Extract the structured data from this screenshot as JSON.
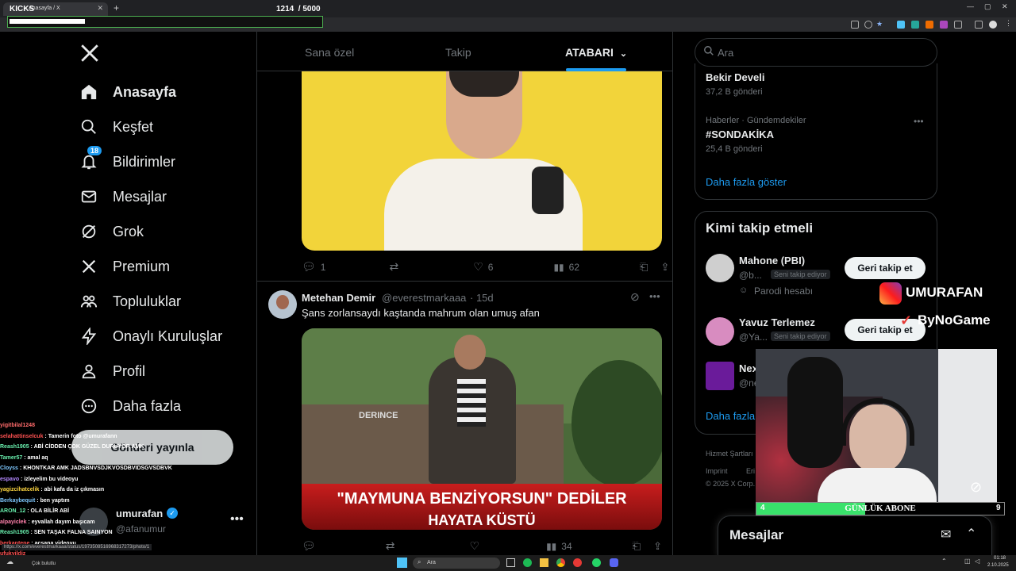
{
  "browser": {
    "tab_title": "Anasayfa / X",
    "overlay_title": "KICKS",
    "counter": "1214  / 5000"
  },
  "sidebar": {
    "items": [
      {
        "label": "Anasayfa",
        "icon": "home-icon"
      },
      {
        "label": "Keşfet",
        "icon": "search-icon"
      },
      {
        "label": "Bildirimler",
        "icon": "bell-icon",
        "badge": "18"
      },
      {
        "label": "Mesajlar",
        "icon": "mail-icon"
      },
      {
        "label": "Grok",
        "icon": "grok-icon"
      },
      {
        "label": "Premium",
        "icon": "x-icon"
      },
      {
        "label": "Topluluklar",
        "icon": "people-icon"
      },
      {
        "label": "Onaylı Kuruluşlar",
        "icon": "lightning-icon"
      },
      {
        "label": "Profil",
        "icon": "person-icon"
      },
      {
        "label": "Daha fazla",
        "icon": "more-circle-icon"
      }
    ],
    "post_button": "Gönderi yayınla",
    "account": {
      "name": "umurafan",
      "handle": "@afanumur"
    }
  },
  "feed": {
    "tabs": [
      "Sana özel",
      "Takip",
      "ATABARI"
    ],
    "post1_actions": {
      "replies": "1",
      "likes": "6",
      "views": "62"
    },
    "post2": {
      "author": "Metehan Demir",
      "handle": "@everestmarkaaa",
      "time": "· 15d",
      "text": "Şans zorlansaydı kaştanda mahrum olan umuş afan",
      "image_caption_1": "\"MAYMUNA BENZİYORSUN\" DEDİLER",
      "image_caption_2": "HAYATA KÜSTÜ",
      "bench_text": "DERINCE",
      "views": "34"
    }
  },
  "right": {
    "search_placeholder": "Ara",
    "trend1": {
      "name": "Bekir Develi",
      "count": "37,2 B gönderi"
    },
    "trend2": {
      "meta": "Haberler · Gündemdekiler",
      "name": "#SONDAKİKA",
      "count": "25,4 B gönderi"
    },
    "show_more": "Daha fazla göster",
    "who_to_follow": "Kimi takip etmeli",
    "users": [
      {
        "name": "Mahone (PBI)",
        "handle": "@b...",
        "tag": "Seni takip ediyor",
        "note": "Parodi hesabı",
        "button": "Geri takip et"
      },
      {
        "name": "Yavuz Terlemez",
        "handle": "@Ya...",
        "tag": "Seni takip ediyor",
        "button": "Geri takip et"
      },
      {
        "name": "Nex",
        "handle": "@ne"
      }
    ],
    "show_more_2": "Daha fazla",
    "footer1": "Hizmet Şartları",
    "footer2": "Imprint",
    "footer3": "Eri",
    "footer4": "© 2025 X Corp.",
    "messages": "Mesajlar"
  },
  "stream": {
    "insta": "UMURAFAN",
    "sponsor": "ByNoGame",
    "sub_left": "4",
    "sub_label": "GÜNLÜK ABONE",
    "sub_right": "9",
    "sub_progress": 0.44
  },
  "chat": [
    {
      "user": "yigitbilal1248",
      "msg": "",
      "color": "#ff6b6b"
    },
    {
      "user": "selahattinselcuk",
      "msg": "Tamerin foto @umurafann",
      "color": "#ff5252"
    },
    {
      "user": "Reash1905",
      "msg": "ABİ CİDDEN ÇOK GÜZEL DURUYOR AMK",
      "color": "#69f0ae"
    },
    {
      "user": "Tamer57",
      "msg": "amal aq",
      "color": "#69f0ae"
    },
    {
      "user": "Cloyss",
      "msg": "KHONTKAR AMK JADSBNVSDJKVOSDBVIDSGVSDBVK",
      "color": "#7ec8ff"
    },
    {
      "user": "espavo",
      "msg": "izleyelim bu videoyu",
      "color": "#b388ff"
    },
    {
      "user": "yagizcihatcelik",
      "msg": "abi kafa da iz çıkmasın",
      "color": "#ffd740"
    },
    {
      "user": "Berkaybequit",
      "msg": "ben yaptım",
      "color": "#7ec8ff"
    },
    {
      "user": "ARON_12",
      "msg": "OLA BİLİR ABİ",
      "color": "#69f0ae"
    },
    {
      "user": "alpayiclek",
      "msg": "eyvallah dayım başıcam",
      "color": "#ff80ab"
    },
    {
      "user": "Reash1905",
      "msg": "SEN TAŞAK FALNA SAINYON",
      "color": "#69f0ae"
    },
    {
      "user": "berkantepe",
      "msg": "açsana videoyu",
      "color": "#ff5252"
    },
    {
      "user": "ufukyildiz",
      "msg": "",
      "color": "#ff5252"
    }
  ],
  "status_url": "https://x.com/everestmarkaaa/status/1973508516968317273/photo/1",
  "taskbar": {
    "weather": "Çok bulutlu",
    "search": "Ara",
    "time": "01:18",
    "date": "2.10.2025"
  },
  "colors": {
    "accent": "#1d9bf0",
    "bg": "#000000",
    "border": "#2f3336",
    "muted": "#71767b"
  }
}
